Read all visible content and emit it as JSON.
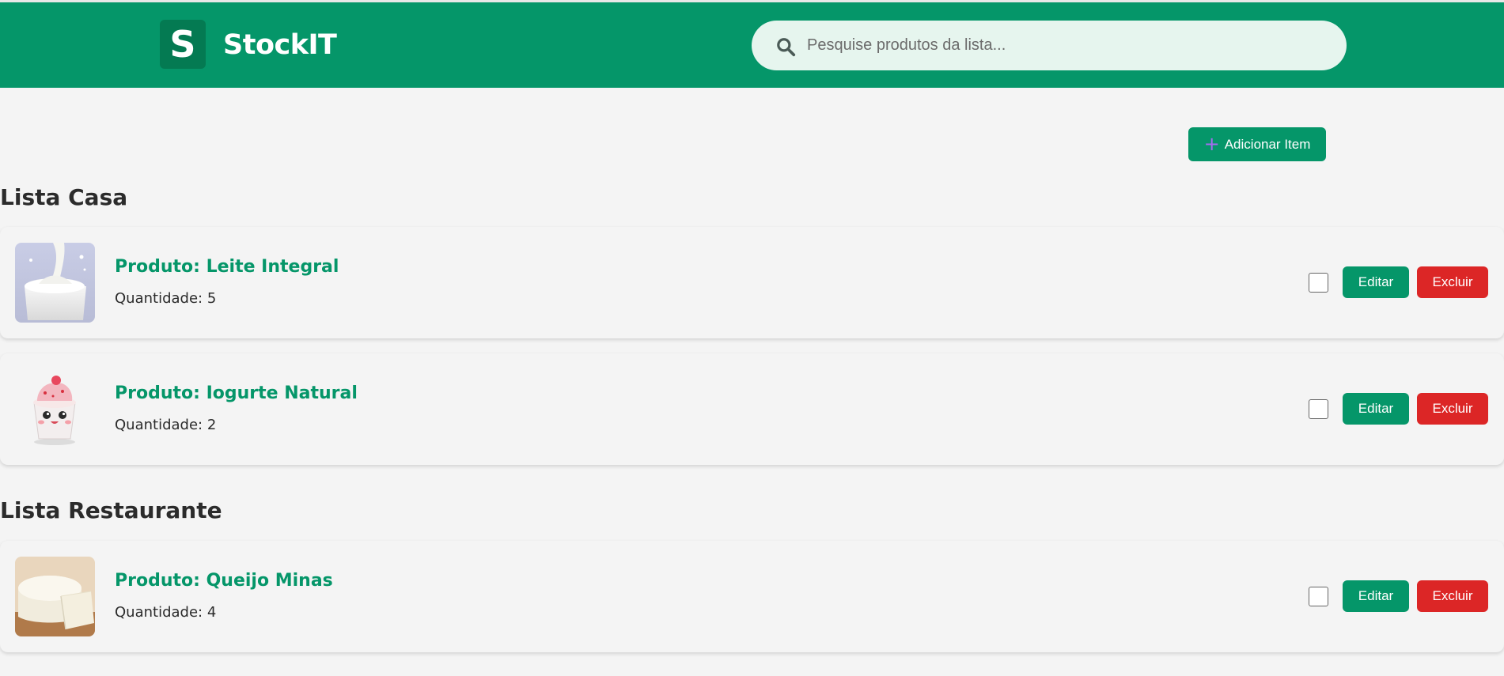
{
  "header": {
    "logo_letter": "S",
    "brand": "StockIT",
    "search_placeholder": "Pesquise produtos da lista...",
    "search_value": ""
  },
  "toolbar": {
    "add_label": "Adicionar Item"
  },
  "lists": [
    {
      "title": "Lista Casa",
      "items": [
        {
          "name": "Produto: Leite Integral",
          "quantity": "Quantidade: 5",
          "image": "milk-image",
          "checked": false,
          "edit_label": "Editar",
          "delete_label": "Excluir"
        },
        {
          "name": "Produto: Iogurte Natural",
          "quantity": "Quantidade: 2",
          "image": "yogurt-image",
          "checked": false,
          "edit_label": "Editar",
          "delete_label": "Excluir"
        }
      ]
    },
    {
      "title": "Lista Restaurante",
      "items": [
        {
          "name": "Produto: Queijo Minas",
          "quantity": "Quantidade: 4",
          "image": "cheese-image",
          "checked": false,
          "edit_label": "Editar",
          "delete_label": "Excluir"
        }
      ]
    }
  ],
  "colors": {
    "brand_green": "#059669",
    "danger_red": "#dc2626",
    "background": "#f4f4f4",
    "search_bg": "#e6f5ee"
  }
}
